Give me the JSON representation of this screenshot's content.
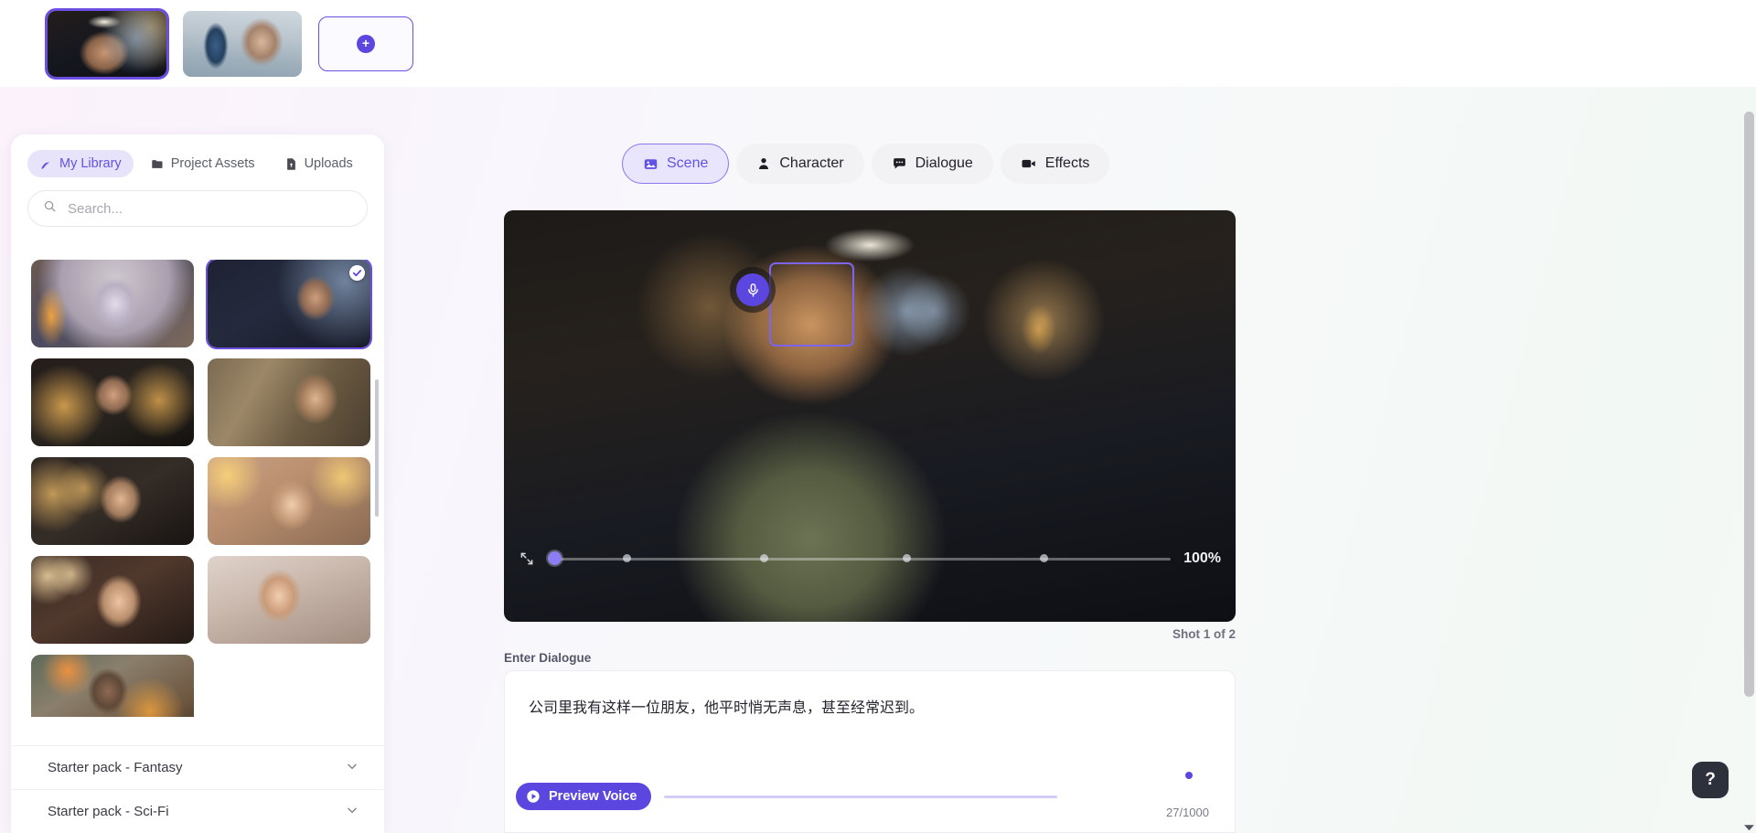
{
  "shot_strip": {
    "shots": [
      {
        "name": "shot-1",
        "selected": true
      },
      {
        "name": "shot-2",
        "selected": false
      }
    ],
    "add_label": "+"
  },
  "library": {
    "tabs": [
      {
        "label": "My Library",
        "icon": "library-icon",
        "active": true
      },
      {
        "label": "Project Assets",
        "icon": "folder-icon",
        "active": false
      },
      {
        "label": "Uploads",
        "icon": "upload-file-icon",
        "active": false
      }
    ],
    "search": {
      "placeholder": "Search...",
      "value": "",
      "icon": "search-icon"
    },
    "assets": [
      {
        "id": "asset-1",
        "alt": "Elderly woman reading glowing book by fireplace",
        "selected": false
      },
      {
        "id": "asset-2",
        "alt": "Young man in jacket at dim bar",
        "selected": true
      },
      {
        "id": "asset-3",
        "alt": "Young man with microphone in warm lit room",
        "selected": false
      },
      {
        "id": "asset-4",
        "alt": "Young man in library with bookshelves",
        "selected": false
      },
      {
        "id": "asset-5",
        "alt": "Man in hoodie with warm bokeh lights",
        "selected": false
      },
      {
        "id": "asset-6",
        "alt": "Woman at desk with bright window light",
        "selected": false
      },
      {
        "id": "asset-7",
        "alt": "Woman with microphone in warm cafe",
        "selected": false
      },
      {
        "id": "asset-8",
        "alt": "Woman in bright interior portrait",
        "selected": false
      },
      {
        "id": "asset-9",
        "alt": "Older man with glasses by fireplace",
        "selected": false
      }
    ],
    "collapsibles": [
      {
        "label": "Starter pack - Fantasy",
        "expanded": false
      },
      {
        "label": "Starter pack - Sci-Fi",
        "expanded": false
      }
    ]
  },
  "editor_tabs": [
    {
      "label": "Scene",
      "icon": "image-icon",
      "active": true
    },
    {
      "label": "Character",
      "icon": "person-icon",
      "active": false
    },
    {
      "label": "Dialogue",
      "icon": "chat-bubble-icon",
      "active": false
    },
    {
      "label": "Effects",
      "icon": "video-camera-icon",
      "active": false
    }
  ],
  "preview": {
    "face_selection": {
      "mic_icon": "microphone-icon",
      "label": ""
    },
    "zoom": {
      "value_label": "100%",
      "percent": 5,
      "ticks": 4,
      "expand_icon": "expand-arrows-icon"
    },
    "shot_counter": "Shot 1 of 2"
  },
  "dialogue": {
    "label": "Enter Dialogue",
    "value": "公司里我有这样一位朋友，他平时悄无声息，甚至经常迟到。",
    "placeholder": "",
    "preview_button": {
      "label": "Preview Voice",
      "icon": "play-icon"
    },
    "char_count": "27/1000"
  },
  "help": {
    "label": "?"
  },
  "colors": {
    "accent": "#5b47e0",
    "accent_soft": "#e8e5fc",
    "accent_text": "#6253e3",
    "tab_bg": "#f2f2f5",
    "panel_bg": "#ffffff",
    "help_bg": "#2d313c"
  }
}
